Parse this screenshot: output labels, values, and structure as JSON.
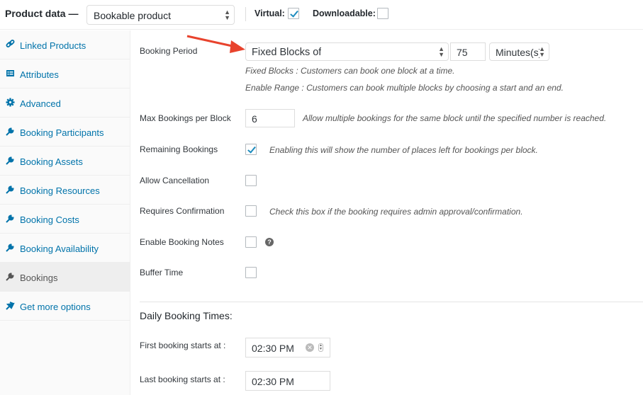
{
  "header": {
    "title": "Product data —",
    "product_type": "Bookable product",
    "virtual_label": "Virtual:",
    "virtual_checked": true,
    "downloadable_label": "Downloadable:",
    "downloadable_checked": false
  },
  "sidebar": {
    "items": [
      {
        "label": "Linked Products",
        "icon": "link-icon",
        "active": false
      },
      {
        "label": "Attributes",
        "icon": "list-icon",
        "active": false
      },
      {
        "label": "Advanced",
        "icon": "gear-icon",
        "active": false
      },
      {
        "label": "Booking Participants",
        "icon": "wrench-icon",
        "active": false
      },
      {
        "label": "Booking Assets",
        "icon": "wrench-icon",
        "active": false
      },
      {
        "label": "Booking Resources",
        "icon": "wrench-icon",
        "active": false
      },
      {
        "label": "Booking Costs",
        "icon": "wrench-icon",
        "active": false
      },
      {
        "label": "Booking Availability",
        "icon": "wrench-icon",
        "active": false
      },
      {
        "label": "Bookings",
        "icon": "wrench-icon",
        "active": true
      },
      {
        "label": "Get more options",
        "icon": "plugin-icon",
        "active": false
      }
    ]
  },
  "main": {
    "booking_period": {
      "label": "Booking Period",
      "type_value": "Fixed Blocks of",
      "duration_value": "75",
      "unit_value": "Minutes(s)",
      "desc_fixed": "Fixed Blocks : Customers can book one block at a time.",
      "desc_range": "Enable Range : Customers can book multiple blocks by choosing a start and an end."
    },
    "max_bookings": {
      "label": "Max Bookings per Block",
      "value": "6",
      "desc": "Allow multiple bookings for the same block until the specified number is reached."
    },
    "remaining_bookings": {
      "label": "Remaining Bookings",
      "checked": true,
      "desc": "Enabling this will show the number of places left for bookings per block."
    },
    "allow_cancellation": {
      "label": "Allow Cancellation",
      "checked": false
    },
    "requires_confirmation": {
      "label": "Requires Confirmation",
      "checked": false,
      "desc": "Check this box if the booking requires admin approval/confirmation."
    },
    "enable_booking_notes": {
      "label": "Enable Booking Notes",
      "checked": false,
      "help": "?"
    },
    "buffer_time": {
      "label": "Buffer Time",
      "checked": false
    },
    "daily_times": {
      "title": "Daily Booking Times:",
      "first_label": "First booking starts at :",
      "first_value": "02:30 PM",
      "last_label": "Last booking starts at :",
      "last_value": "02:30 PM"
    }
  },
  "colors": {
    "link": "#0073aa",
    "accent_check": "#1e8cbe",
    "annotation_arrow": "#e8432d"
  }
}
